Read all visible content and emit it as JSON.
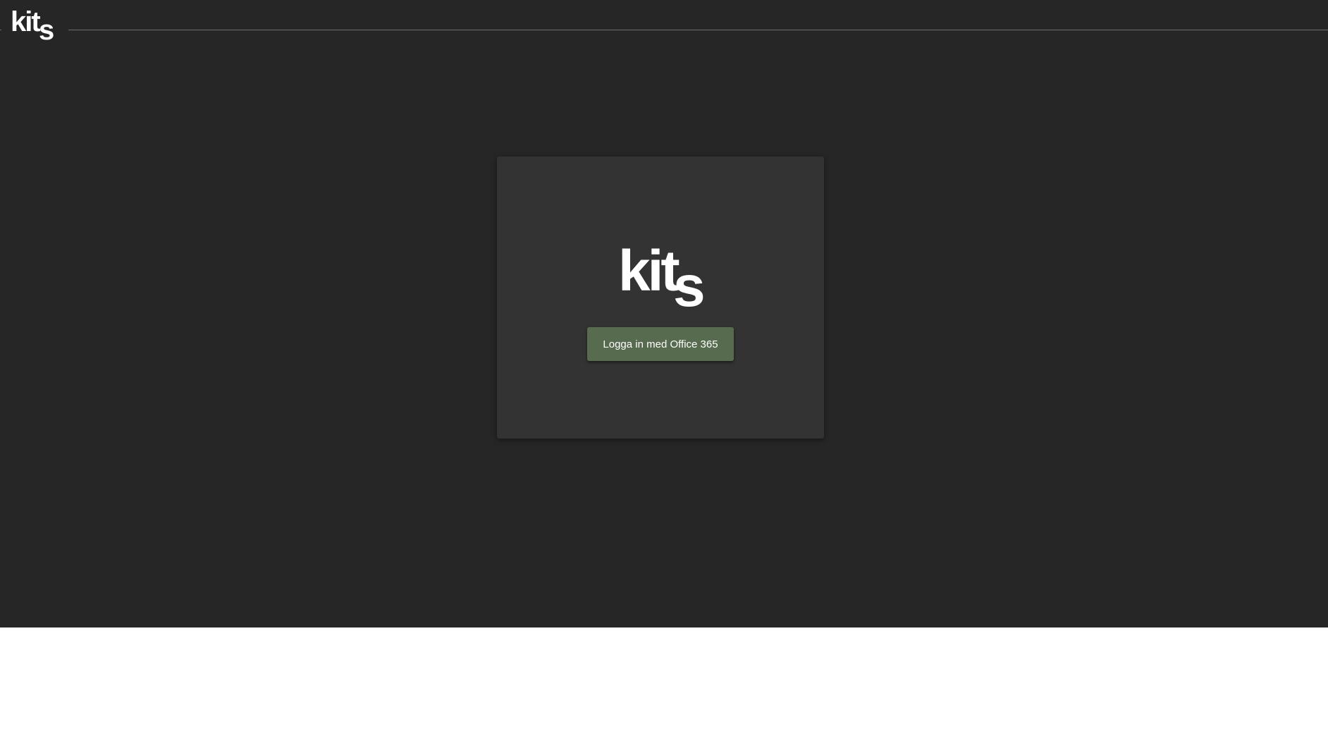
{
  "brand": {
    "logo_text_main": "kit",
    "logo_text_sub": "s",
    "logo_color": "#ffffff"
  },
  "login": {
    "button_label": "Logga in med Office 365",
    "button_color": "#576b4e"
  },
  "colors": {
    "background": "#262626",
    "card": "#333333",
    "rule": "#6e6e6e"
  }
}
